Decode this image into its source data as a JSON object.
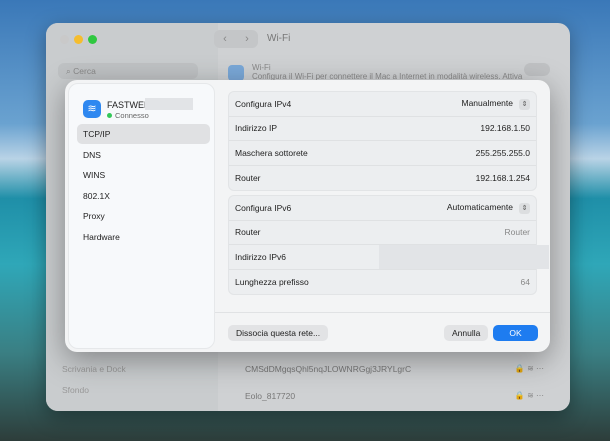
{
  "window": {
    "title": "Wi-Fi",
    "search_placeholder": "Cerca",
    "wifi_label": "Wi-Fi",
    "wifi_desc": "Configura il Wi-Fi per connettere il Mac a Internet in modalità wireless. Attiva",
    "sidebar_items": [
      "Scrivania e Dock",
      "Sfondo"
    ],
    "networks": [
      "CMSdDMgqsQhl5nqJLOWNRGgj3JRYLgrC",
      "Eolo_817720"
    ]
  },
  "dialog": {
    "network_name": "FASTWEB",
    "status": "Connesso",
    "tabs": [
      "TCP/IP",
      "DNS",
      "WINS",
      "802.1X",
      "Proxy",
      "Hardware"
    ],
    "ipv4": [
      {
        "label": "Configura IPv4",
        "value": "Manualmente"
      },
      {
        "label": "Indirizzo IP",
        "value": "192.168.1.50"
      },
      {
        "label": "Maschera sottorete",
        "value": "255.255.255.0"
      },
      {
        "label": "Router",
        "value": "192.168.1.254"
      }
    ],
    "ipv6": [
      {
        "label": "Configura IPv6",
        "value": "Automaticamente"
      },
      {
        "label": "Router",
        "value": "Router"
      },
      {
        "label": "Indirizzo IPv6",
        "value": ""
      },
      {
        "label": "Lunghezza prefisso",
        "value": "64"
      }
    ],
    "forget_button": "Dissocia questa rete...",
    "cancel_button": "Annulla",
    "ok_button": "OK"
  },
  "colors": {
    "accent": "#1e7cf0",
    "connected": "#34c759"
  }
}
